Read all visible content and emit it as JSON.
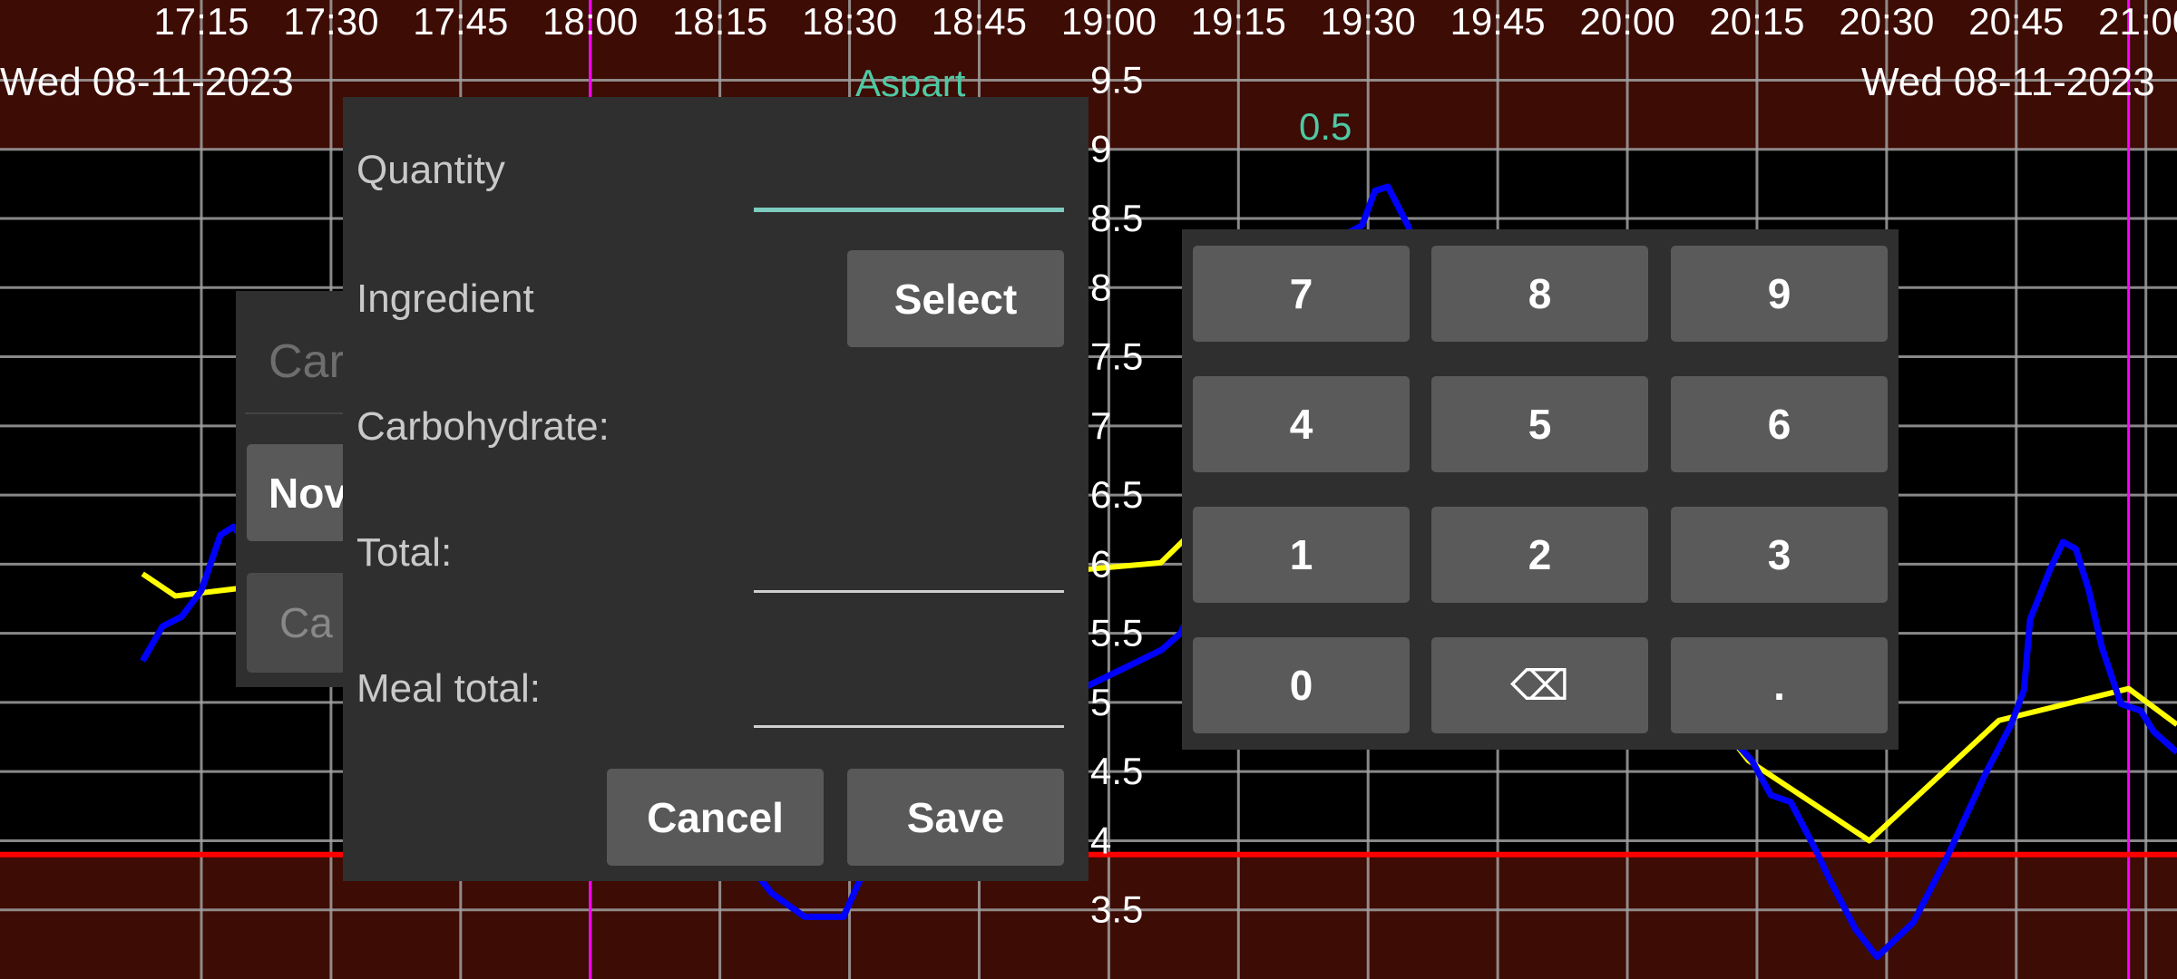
{
  "chart_data": {
    "type": "line",
    "x_unit": "minutes since 17:00",
    "x_tick_labels": [
      "17:15",
      "17:30",
      "17:45",
      "18:00",
      "18:15",
      "18:30",
      "18:45",
      "19:00",
      "19:15",
      "19:30",
      "19:45",
      "20:00",
      "20:15",
      "20:30",
      "20:45",
      "21:00"
    ],
    "x_ticks": [
      15,
      30,
      45,
      60,
      75,
      90,
      105,
      120,
      135,
      150,
      165,
      180,
      195,
      210,
      225,
      240
    ],
    "y_tick_labels": [
      "9.5",
      "9",
      "8.5",
      "8",
      "7.5",
      "7",
      "6.5",
      "6",
      "5.5",
      "5",
      "4.5",
      "4",
      "3.5"
    ],
    "y_ticks": [
      9.5,
      9,
      8.5,
      8,
      7.5,
      7,
      6.5,
      6,
      5.5,
      5,
      4.5,
      4,
      3.5
    ],
    "ylim": [
      3.0,
      10.08
    ],
    "xlim": [
      -8.3,
      243.6
    ],
    "target_range": [
      3.9,
      9.0
    ],
    "highlight_times": [
      60,
      238
    ],
    "colors": {
      "glucose": "#0000ff",
      "trend": "#ffff00",
      "low_limit": "#ff0000",
      "marker": "#ff00ff",
      "out_of_range_bg": "#3d0c05",
      "insulin": "#4ec9a4"
    },
    "series": [
      {
        "name": "glucose",
        "points": [
          [
            8.2,
            5.3
          ],
          [
            10.5,
            5.55
          ],
          [
            12.7,
            5.62
          ],
          [
            15,
            5.81
          ],
          [
            17.2,
            6.21
          ],
          [
            18.7,
            6.27
          ],
          [
            20.2,
            6.16
          ],
          [
            22.5,
            5.91
          ],
          [
            24.7,
            5.81
          ],
          [
            27,
            5.81
          ],
          [
            29.2,
            5.72
          ],
          [
            30.8,
            5.83
          ],
          [
            32.3,
            5.79
          ],
          [
            33.8,
            5.81
          ],
          [
            53.3,
            5.3
          ],
          [
            71.3,
            4.38
          ],
          [
            81,
            3.62
          ],
          [
            84.8,
            3.45
          ],
          [
            89.3,
            3.45
          ],
          [
            92.3,
            3.87
          ],
          [
            113.3,
            4.99
          ],
          [
            126.1,
            5.38
          ],
          [
            128.3,
            5.5
          ],
          [
            130.6,
            5.81
          ],
          [
            132.8,
            6.21
          ],
          [
            135.1,
            7.03
          ],
          [
            136.6,
            7.54
          ],
          [
            143.3,
            8.25
          ],
          [
            149.3,
            8.45
          ],
          [
            150.8,
            8.7
          ],
          [
            152.3,
            8.73
          ],
          [
            154.6,
            8.45
          ],
          [
            158.3,
            7.84
          ],
          [
            173.4,
            6.01
          ],
          [
            188.4,
            4.99
          ],
          [
            194.4,
            4.58
          ],
          [
            196.6,
            4.33
          ],
          [
            198.9,
            4.28
          ],
          [
            201.9,
            3.92
          ],
          [
            203.4,
            3.72
          ],
          [
            206.4,
            3.36
          ],
          [
            208.9,
            3.16
          ],
          [
            213.1,
            3.41
          ],
          [
            216.9,
            3.87
          ],
          [
            221.4,
            4.48
          ],
          [
            224.4,
            4.84
          ],
          [
            225.9,
            5.09
          ],
          [
            226.6,
            5.6
          ],
          [
            228.9,
            5.96
          ],
          [
            230.4,
            6.16
          ],
          [
            231.9,
            6.11
          ],
          [
            233.4,
            5.81
          ],
          [
            234.9,
            5.4
          ],
          [
            237.1,
            4.99
          ],
          [
            239.4,
            4.94
          ],
          [
            240.9,
            4.79
          ],
          [
            243.6,
            4.64
          ]
        ]
      },
      {
        "name": "trend",
        "points": [
          [
            8.2,
            5.93
          ],
          [
            12,
            5.77
          ],
          [
            28,
            5.89
          ],
          [
            46,
            5.8
          ],
          [
            75,
            5.75
          ],
          [
            106,
            5.9
          ],
          [
            126,
            6.01
          ],
          [
            136,
            6.62
          ],
          [
            160,
            7.3
          ],
          [
            194,
            4.58
          ],
          [
            208,
            4.0
          ],
          [
            223,
            4.87
          ],
          [
            238,
            5.1
          ],
          [
            243.6,
            4.84
          ]
        ]
      }
    ]
  },
  "header": {
    "date_left": "Wed 08-11-2023",
    "date_right": "Wed 08-11-2023",
    "insulin_name": "Aspart",
    "insulin_dose": "0.5"
  },
  "back_dialog": {
    "input_placeholder": "Car",
    "button1": "Nov",
    "button2": "Ca"
  },
  "dialog": {
    "quantity_label": "Quantity",
    "quantity_value": "",
    "ingredient_label": "Ingredient",
    "select_button": "Select",
    "carbohydrate_label": "Carbohydrate:",
    "total_label": "Total:",
    "total_value": "",
    "meal_total_label": "Meal total:",
    "meal_total_value": "",
    "cancel_button": "Cancel",
    "save_button": "Save"
  },
  "keypad": {
    "keys": [
      "7",
      "8",
      "9",
      "4",
      "5",
      "6",
      "1",
      "2",
      "3",
      "0",
      "⌫",
      "."
    ]
  }
}
